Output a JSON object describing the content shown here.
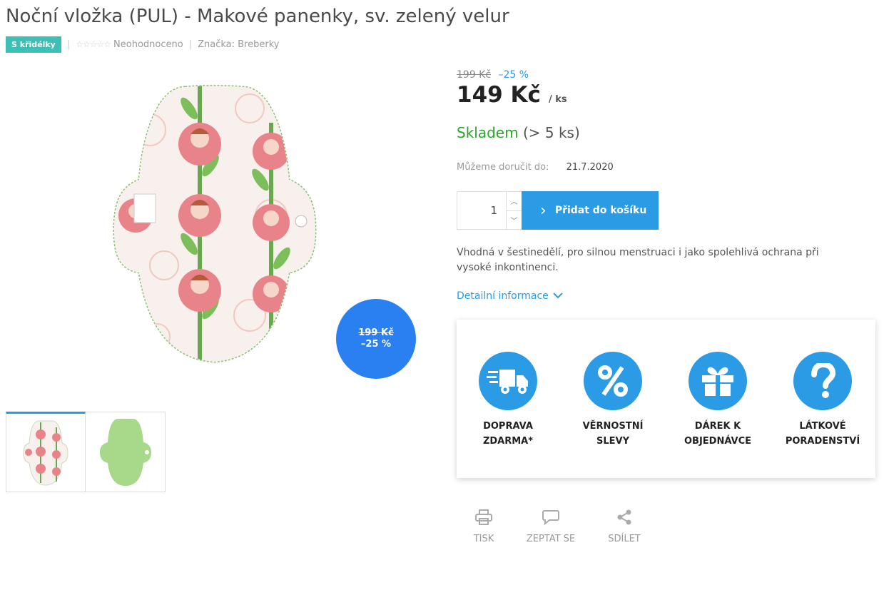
{
  "product": {
    "title": "Noční vložka (PUL) - Makové panenky, sv. zelený velur",
    "badge": "S křidélky",
    "rating_text": "Neohodnoceno",
    "brand_label": "Značka: Breberky"
  },
  "sale_circle": {
    "old_price": "199 Kč",
    "discount": "–25 %"
  },
  "pricing": {
    "old_price": "199 Kč",
    "discount": "–25 %",
    "price": "149 Kč",
    "unit": "/ ks"
  },
  "stock": {
    "status": "Skladem",
    "count": "(> 5 ks)"
  },
  "delivery": {
    "label": "Můžeme doručit do:",
    "date": "21.7.2020"
  },
  "cart": {
    "quantity": "1",
    "add_label": "Přidat do košíku"
  },
  "description": "Vhodná v šestinedělí, pro silnou menstruaci i jako spolehlivá ochrana při vysoké inkontinenci.",
  "detail_link": "Detailní informace",
  "benefits": [
    {
      "icon": "truck-icon",
      "line1": "DOPRAVA",
      "line2": "ZDARMA*"
    },
    {
      "icon": "percent-icon",
      "line1": "VĚRNOSTNÍ",
      "line2": "SLEVY"
    },
    {
      "icon": "gift-icon",
      "line1": "DÁREK K",
      "line2": "OBJEDNÁVCE"
    },
    {
      "icon": "question-icon",
      "line1": "LÁTKOVÉ",
      "line2": "PORADENSTVÍ"
    }
  ],
  "actions": {
    "print": "TISK",
    "ask": "ZEPTAT SE",
    "share": "SDÍLET"
  },
  "colors": {
    "accent": "#2a9be4",
    "badge": "#3ebfb5",
    "stock_green": "#2aa52a",
    "sale_circle": "#2a80f0"
  }
}
